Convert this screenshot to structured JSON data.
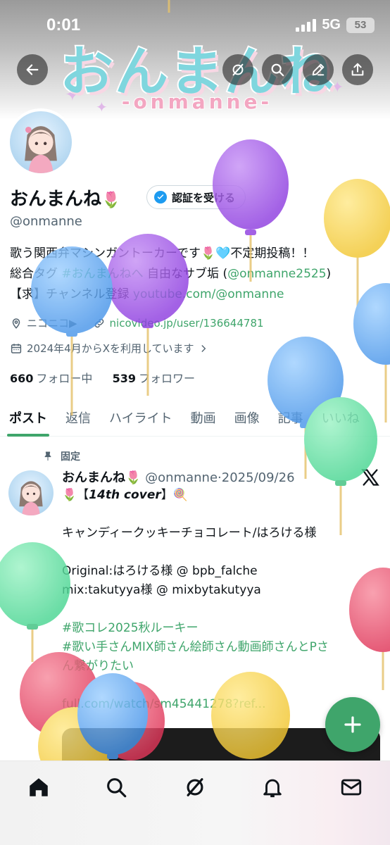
{
  "status_bar": {
    "time": "0:01",
    "network": "5G",
    "battery": "53"
  },
  "banner": {
    "title": "おんまんね",
    "subtitle": "-onmanne-"
  },
  "header_buttons": [
    {
      "name": "back-button",
      "icon": "arrow-left-icon"
    },
    {
      "name": "grok-button",
      "icon": "grok-icon"
    },
    {
      "name": "search-button",
      "icon": "search-icon"
    },
    {
      "name": "edit-button",
      "icon": "pen-icon"
    },
    {
      "name": "share-button",
      "icon": "share-icon"
    }
  ],
  "profile": {
    "display_name": "おんまんね",
    "name_emoji": "🌷",
    "verify_label": "認証を受ける",
    "handle": "@onmanne",
    "bio": {
      "line1": "歌う関西弁マシンガントーカーです🌷🩵不定期投稿！！",
      "line2_prefix": "総合タグ ",
      "line2_tag": "#おんまんねへ",
      "line2_mid": " 自由なサブ垢 (",
      "line2_link": "@onmanne2525",
      "line2_suffix": ")",
      "line3_prefix": "【求】チャンネル登録 ",
      "line3_link": "youtube.com/@onmanne"
    },
    "location": "ニコニコ▶",
    "website": "nicovideo.jp/user/136644781",
    "joined": "2024年4月からXを利用しています",
    "following_count": "660",
    "following_label": "フォロー中",
    "followers_count": "539",
    "followers_label": "フォロワー"
  },
  "tabs": [
    {
      "label": "ポスト",
      "active": true
    },
    {
      "label": "返信",
      "active": false
    },
    {
      "label": "ハイライト",
      "active": false
    },
    {
      "label": "動画",
      "active": false
    },
    {
      "label": "画像",
      "active": false
    },
    {
      "label": "記事",
      "active": false
    },
    {
      "label": "いいね",
      "active": false
    }
  ],
  "pinned_post": {
    "pinned_label": "固定",
    "author_name": "おんまんね🌷",
    "author_handle": "@onmanne",
    "date": "2025/09/26",
    "line1_prefix": "🌷【",
    "line1_italic": "14th cover",
    "line1_suffix": "】🍭",
    "line2": "キャンディークッキーチョコレート/はろける様",
    "line3": "Original:はろける様 @ bpb_falche",
    "line4": "mix:takutyya様 @ mixbytakutyya",
    "hashtag1": "#歌コレ2025秋ルーキー",
    "hashtag2": "#歌い手さんMIX師さん絵師さん動画師さんとPさ",
    "hashtag2_cont": "ん繋がりたい",
    "link": "full.com/watch/sm45441278?ref..."
  },
  "bottom_nav": [
    {
      "name": "home-icon"
    },
    {
      "name": "search-icon"
    },
    {
      "name": "grok-icon"
    },
    {
      "name": "bell-icon"
    },
    {
      "name": "mail-icon"
    }
  ],
  "colors": {
    "accent_green": "#3fa56b",
    "muted_text": "#536471",
    "verify_blue": "#1d9bf0",
    "text": "#0f1419"
  }
}
